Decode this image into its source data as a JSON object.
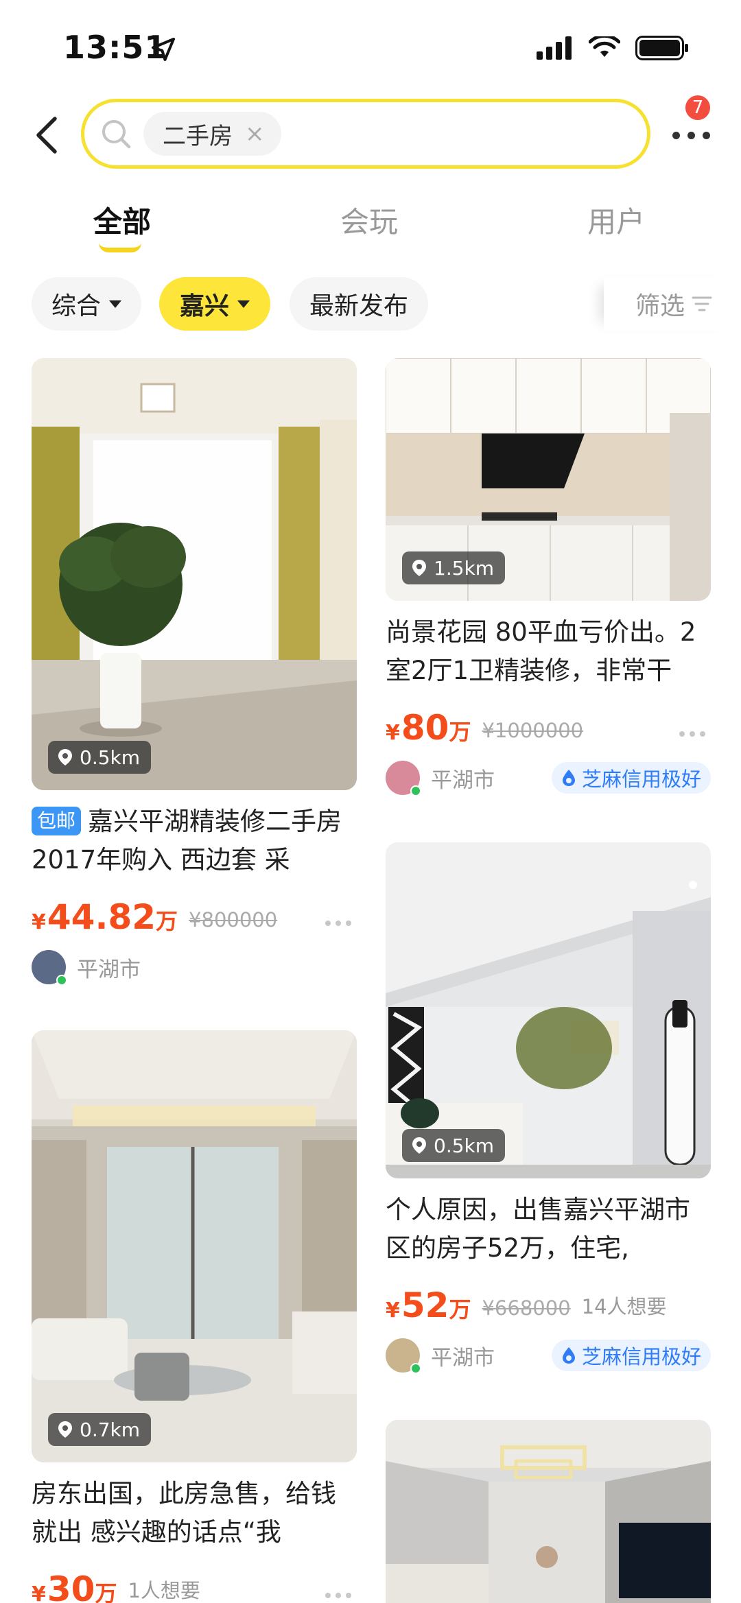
{
  "status_bar": {
    "time": "13:51"
  },
  "header": {
    "search_chip": "二手房",
    "chip_close": "×",
    "notification_count": "7"
  },
  "tabs": [
    {
      "label": "全部",
      "active": true
    },
    {
      "label": "会玩",
      "active": false
    },
    {
      "label": "用户",
      "active": false
    }
  ],
  "filters": {
    "sort": "综合",
    "city": "嘉兴",
    "latest": "最新发布",
    "filter_btn": "筛选"
  },
  "listings": [
    {
      "distance": "0.5km",
      "tag": "包邮",
      "title": "嘉兴平湖精装修二手房 2017年购入 西边套 采",
      "price_yen": "¥",
      "price_num": "44.82",
      "price_unit": "万",
      "original_price": "¥800000",
      "want_count": "",
      "location": "平湖市",
      "credit": ""
    },
    {
      "distance": "1.5km",
      "tag": "",
      "title": "尚景花园 80平血亏价出。2室2厅1卫精装修，非常干",
      "price_yen": "¥",
      "price_num": "80",
      "price_unit": "万",
      "original_price": "¥1000000",
      "want_count": "",
      "location": "平湖市",
      "credit": "芝麻信用极好"
    },
    {
      "distance": "0.5km",
      "tag": "",
      "title": "个人原因，出售嘉兴平湖市区的房子52万，住宅,",
      "price_yen": "¥",
      "price_num": "52",
      "price_unit": "万",
      "original_price": "¥668000",
      "want_count": "14人想要",
      "location": "平湖市",
      "credit": "芝麻信用极好"
    },
    {
      "distance": "0.7km",
      "tag": "",
      "title": "房东出国，此房急售，给钱就出 感兴趣的话点“我",
      "price_yen": "¥",
      "price_num": "30",
      "price_unit": "万",
      "original_price": "",
      "want_count": "1人想要",
      "location": "",
      "credit": ""
    }
  ],
  "colors": {
    "accent_yellow": "#fde53a",
    "price_red": "#f24d1a",
    "credit_blue": "#2f7cf6",
    "badge_red": "#f24d3e"
  }
}
